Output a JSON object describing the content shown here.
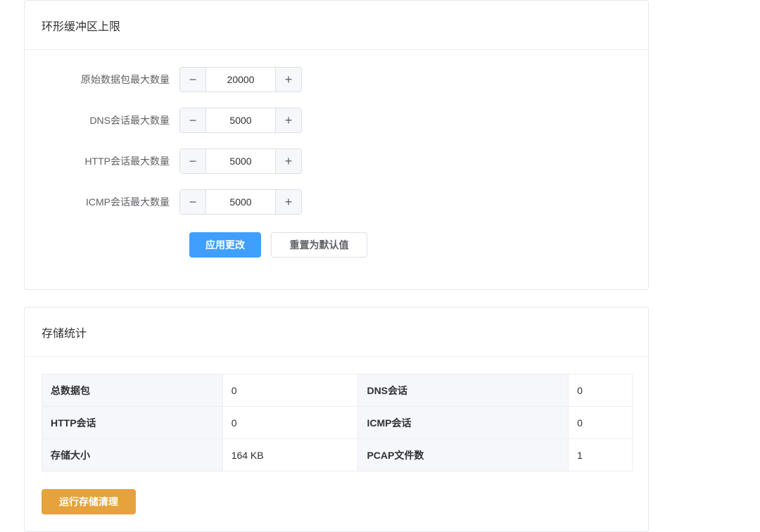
{
  "ring_buffer": {
    "title": "环形缓冲区上限",
    "fields": [
      {
        "label": "原始数据包最大数量",
        "value": "20000"
      },
      {
        "label": "DNS会话最大数量",
        "value": "5000"
      },
      {
        "label": "HTTP会话最大数量",
        "value": "5000"
      },
      {
        "label": "ICMP会话最大数量",
        "value": "5000"
      }
    ],
    "minus_symbol": "−",
    "plus_symbol": "+",
    "apply_label": "应用更改",
    "reset_label": "重置为默认值"
  },
  "storage": {
    "title": "存储统计",
    "rows": [
      {
        "l1": "总数据包",
        "v1": "0",
        "l2": "DNS会话",
        "v2": "0"
      },
      {
        "l1": "HTTP会话",
        "v1": "0",
        "l2": "ICMP会话",
        "v2": "0"
      },
      {
        "l1": "存储大小",
        "v1": "164 KB",
        "l2": "PCAP文件数",
        "v2": "1"
      }
    ],
    "cleanup_label": "运行存储清理"
  },
  "colors": {
    "primary": "#409eff",
    "warning": "#e6a23c",
    "border": "#e4e7ed"
  }
}
